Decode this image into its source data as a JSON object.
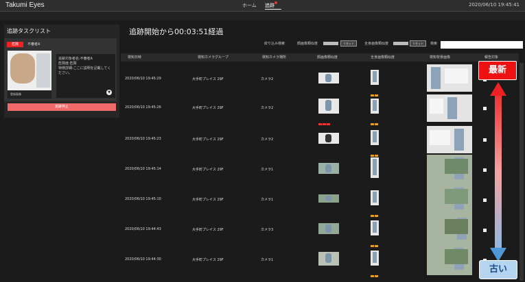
{
  "app": {
    "brand": "Takumi Eyes",
    "clock": "2020/06/10 19:45:41"
  },
  "nav": {
    "home": "ホーム",
    "tracking": "追跡"
  },
  "left": {
    "title": "追跡タスクリスト",
    "card": {
      "tag": "危険",
      "name": "不審者A",
      "face_caption": "登録画像",
      "info_lines": [
        "追跡対象者名:不審者A",
        "危険度:危険",
        "特徴詳細:ここに説明を記載してください。"
      ],
      "stop_label": "追跡停止"
    }
  },
  "main": {
    "elapsed": "追跡開始から00:03:51経過",
    "filters": {
      "narrow": "絞り込み検索",
      "face_sim": "顔画像類似度",
      "body_sim": "全身画像類似度",
      "reset1": "リセット",
      "reset2": "リセット",
      "search_label": "検索"
    },
    "columns": [
      "検知日時",
      "検知カメラグループ",
      "検知カメラ場所",
      "顔画像類似度",
      "全身画像類似度",
      "検知背景画像",
      "報告対象"
    ],
    "rows": [
      {
        "time": "2020/06/10 19:45:29",
        "group": "大手町プレイス 29F",
        "camera": "カメラ2"
      },
      {
        "time": "2020/06/10 19:45:26",
        "group": "大手町プレイス 29F",
        "camera": "カメラ2"
      },
      {
        "time": "2020/06/10 19:45:23",
        "group": "大手町プレイス 29F",
        "camera": "カメラ2"
      },
      {
        "time": "2020/06/10 19:45:14",
        "group": "大手町プレイス 29F",
        "camera": "カメラ1"
      },
      {
        "time": "2020/06/10 19:45:10",
        "group": "大手町プレイス 29F",
        "camera": "カメラ1"
      },
      {
        "time": "2020/06/10 19:44:43",
        "group": "大手町プレイス 29F",
        "camera": "カメラ3"
      },
      {
        "time": "2020/06/10 19:44:30",
        "group": "大手町プレイス 29F",
        "camera": "カメラ1"
      }
    ]
  },
  "overlay": {
    "newest": "最新",
    "oldest": "古い"
  },
  "colors": {
    "danger": "#e22222",
    "stop": "#f06a6a",
    "arrow_bottom": "#4f97d8"
  }
}
